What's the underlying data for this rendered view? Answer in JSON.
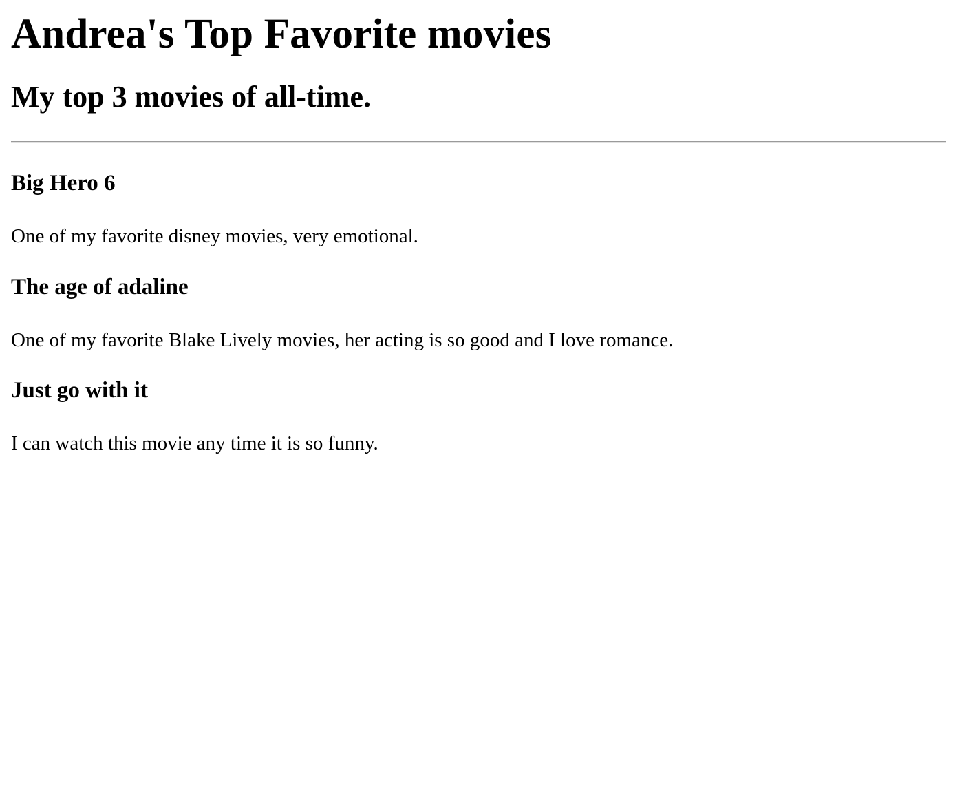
{
  "header": {
    "title": "Andrea's Top Favorite movies",
    "subtitle": "My top 3 movies of all-time."
  },
  "movies": [
    {
      "title": "Big Hero 6",
      "description": "One of my favorite disney movies, very emotional."
    },
    {
      "title": "The age of adaline",
      "description": "One of my favorite Blake Lively movies, her acting is so good and I love romance."
    },
    {
      "title": "Just go with it",
      "description": "I can watch this movie any time it is so funny."
    }
  ]
}
